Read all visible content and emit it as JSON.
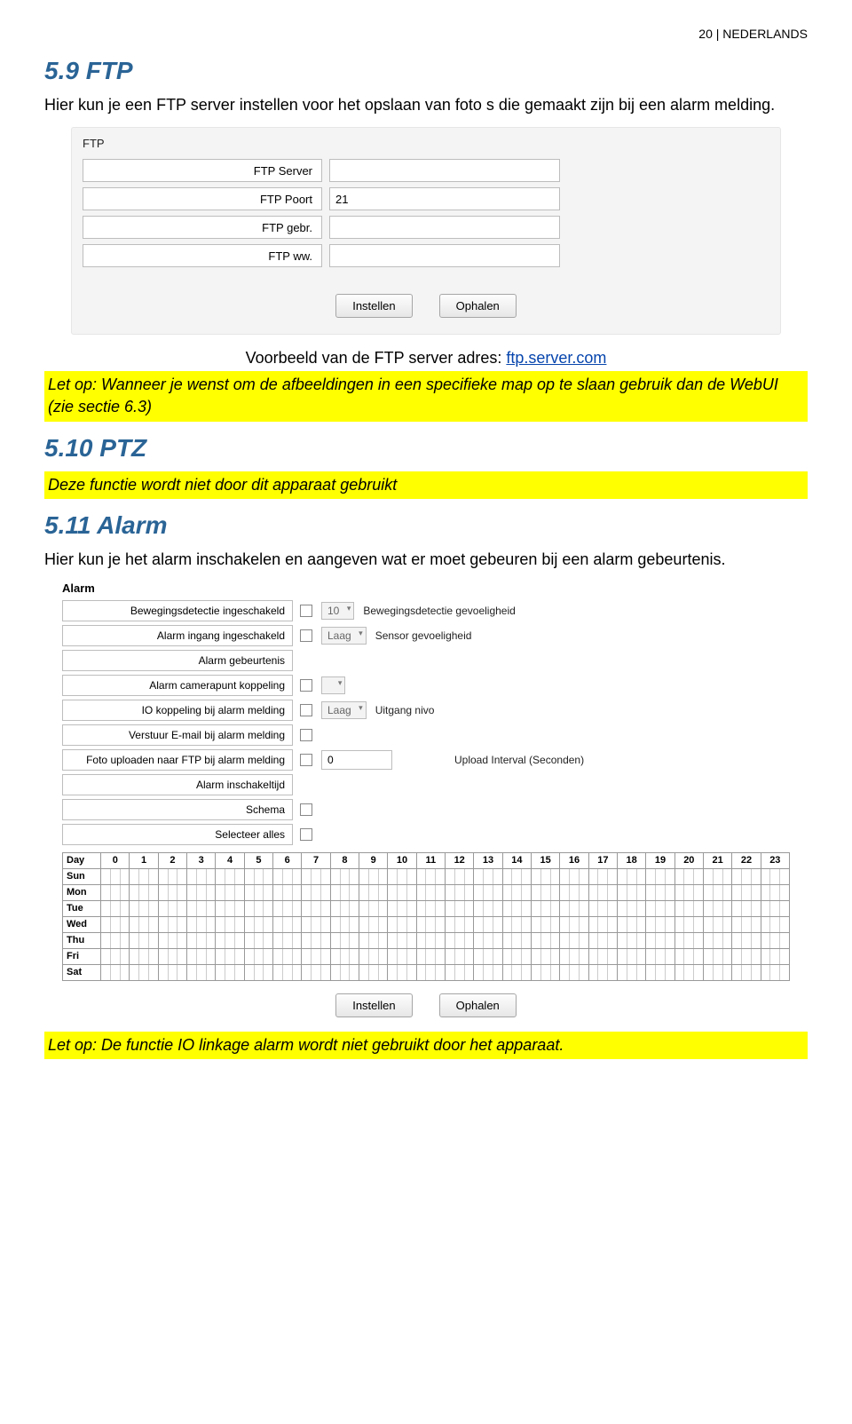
{
  "header": {
    "page": "20",
    "lang": "NEDERLANDS"
  },
  "s59": {
    "title": "5.9 FTP",
    "intro": "Hier kun je een FTP server instellen voor het opslaan van foto s die gemaakt zijn bij een alarm melding.",
    "panel_label": "FTP",
    "fields": {
      "server": "FTP Server",
      "poort": "FTP Poort",
      "poort_val": "21",
      "gebr": "FTP gebr.",
      "ww": "FTP ww."
    },
    "btn_instellen": "Instellen",
    "btn_ophalen": "Ophalen",
    "example_prefix": "Voorbeeld van de FTP server adres: ",
    "example_link": "ftp.server.com",
    "note": "Let op: Wanneer je wenst om de afbeeldingen in een specifieke map op te slaan gebruik dan de WebUI (zie sectie 6.3)"
  },
  "s510": {
    "title": "5.10 PTZ",
    "note": "Deze functie wordt niet door dit apparaat gebruikt"
  },
  "s511": {
    "title": "5.11 Alarm",
    "intro": "Hier kun je het alarm inschakelen en aangeven wat er moet gebeuren bij een alarm gebeurtenis.",
    "panel_label": "Alarm",
    "rows": {
      "r1": {
        "label": "Bewegingsdetectie ingeschakeld",
        "sel": "10",
        "desc": "Bewegingsdetectie gevoeligheid"
      },
      "r2": {
        "label": "Alarm ingang ingeschakeld",
        "sel": "Laag",
        "desc": "Sensor gevoeligheid"
      },
      "r3": {
        "label": "Alarm gebeurtenis"
      },
      "r4": {
        "label": "Alarm camerapunt koppeling"
      },
      "r5": {
        "label": "IO koppeling bij alarm melding",
        "sel": "Laag",
        "desc": "Uitgang nivo"
      },
      "r6": {
        "label": "Verstuur E-mail bij alarm melding"
      },
      "r7": {
        "label": "Foto uploaden naar FTP bij alarm melding",
        "num": "0",
        "desc": "Upload Interval (Seconden)"
      },
      "r8": {
        "label": "Alarm inschakeltijd"
      },
      "r9": {
        "label": "Schema"
      },
      "r10": {
        "label": "Selecteer alles"
      }
    },
    "schedule": {
      "day_header": "Day",
      "hours": [
        "0",
        "1",
        "2",
        "3",
        "4",
        "5",
        "6",
        "7",
        "8",
        "9",
        "10",
        "11",
        "12",
        "13",
        "14",
        "15",
        "16",
        "17",
        "18",
        "19",
        "20",
        "21",
        "22",
        "23"
      ],
      "days": [
        "Sun",
        "Mon",
        "Tue",
        "Wed",
        "Thu",
        "Fri",
        "Sat"
      ]
    },
    "btn_instellen": "Instellen",
    "btn_ophalen": "Ophalen",
    "footer_note": "Let op: De functie IO linkage alarm wordt niet gebruikt door het apparaat."
  }
}
